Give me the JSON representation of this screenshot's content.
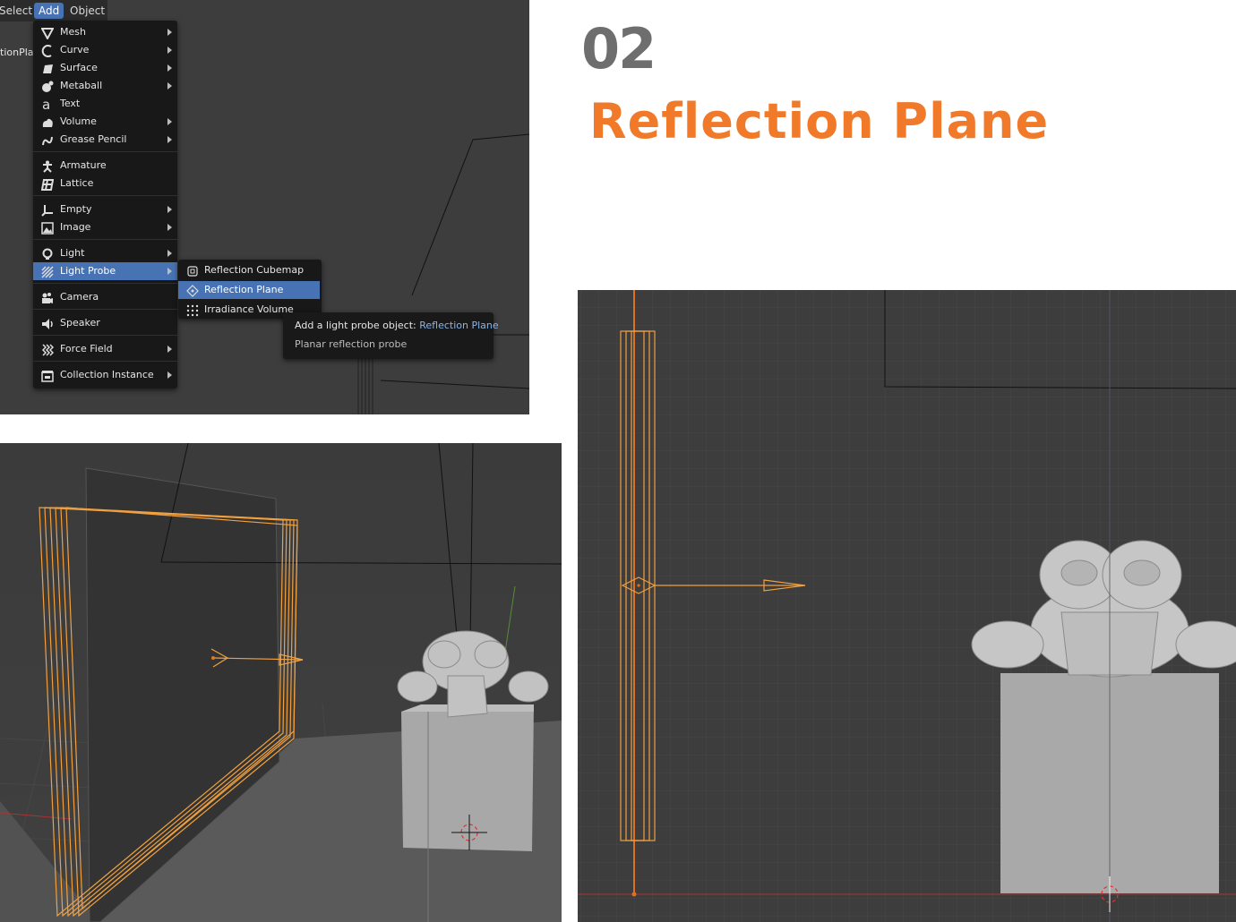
{
  "header": {
    "menus": [
      {
        "label": "Select",
        "active": false
      },
      {
        "label": "Add",
        "active": true
      },
      {
        "label": "Object",
        "active": false
      }
    ],
    "side_label": "tionPla"
  },
  "add_menu": {
    "items": [
      {
        "label": "Mesh",
        "icon": "mesh-icon",
        "submenu": true
      },
      {
        "label": "Curve",
        "icon": "curve-icon",
        "submenu": true
      },
      {
        "label": "Surface",
        "icon": "surface-icon",
        "submenu": true
      },
      {
        "label": "Metaball",
        "icon": "metaball-icon",
        "submenu": true
      },
      {
        "label": "Text",
        "icon": "text-icon",
        "submenu": false
      },
      {
        "label": "Volume",
        "icon": "volume-icon",
        "submenu": true
      },
      {
        "label": "Grease Pencil",
        "icon": "grease-pencil-icon",
        "submenu": true
      },
      {
        "label": "Armature",
        "icon": "armature-icon",
        "submenu": false
      },
      {
        "label": "Lattice",
        "icon": "lattice-icon",
        "submenu": false
      },
      {
        "label": "Empty",
        "icon": "empty-icon",
        "submenu": true
      },
      {
        "label": "Image",
        "icon": "image-icon",
        "submenu": true
      },
      {
        "label": "Light",
        "icon": "light-icon",
        "submenu": true
      },
      {
        "label": "Light Probe",
        "icon": "light-probe-icon",
        "submenu": true,
        "active": true
      },
      {
        "label": "Camera",
        "icon": "camera-icon",
        "submenu": false
      },
      {
        "label": "Speaker",
        "icon": "speaker-icon",
        "submenu": false
      },
      {
        "label": "Force Field",
        "icon": "force-field-icon",
        "submenu": true
      },
      {
        "label": "Collection Instance",
        "icon": "collection-instance-icon",
        "submenu": true
      }
    ]
  },
  "light_probe_menu": {
    "items": [
      {
        "label": "Reflection Cubemap",
        "icon": "reflection-cubemap-icon"
      },
      {
        "label": "Reflection Plane",
        "icon": "reflection-plane-icon",
        "active": true
      },
      {
        "label": "Irradiance Volume",
        "icon": "irradiance-volume-icon"
      }
    ]
  },
  "tooltip": {
    "prefix": "Add a light probe object:",
    "highlight": "Reflection Plane",
    "description": "Planar reflection probe"
  },
  "heading": {
    "number": "02",
    "title": "Reflection Plane"
  },
  "colors": {
    "accent": "#f07a2a",
    "menu_highlight": "#4772b3",
    "number": "#6e6e6e",
    "selection_orange": "#f0a040"
  }
}
